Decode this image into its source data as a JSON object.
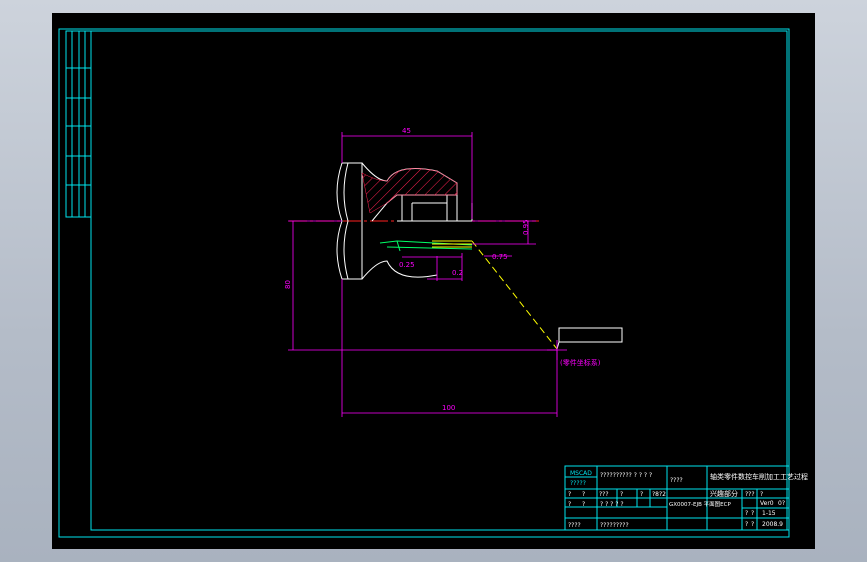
{
  "colors": {
    "frame": "#00e5ee",
    "dimension": "#ff00ff",
    "outline": "#ffffff",
    "centerline": "#ff2020",
    "hatch": "#ff2050",
    "toolpath": "#ffff00",
    "cutter": "#00ff66",
    "title_text": "#ffffff"
  },
  "dimensions": {
    "top_width": "45",
    "height_left": "80",
    "bottom_width": "100",
    "small_r": "0.95",
    "d1": "0.75",
    "d2": "0.25",
    "d3": "0.2"
  },
  "annotations": {
    "origin_label": "(零件坐标系)"
  },
  "title_block": {
    "company_mark": "MSCAD",
    "company_sub": "?????",
    "header_left": "??????????\n ? ? ? ?",
    "header_mid": "????",
    "drawing_title": "轴类零件数控车削加工工艺过程",
    "drawing_sub": "兴趣部分",
    "row1": [
      "?",
      "?",
      "???",
      "?",
      "?",
      "?8?2"
    ],
    "row2": [
      "?",
      "?",
      "? ? ? ? ?"
    ],
    "code": "GX0007-EJB 平面图ECP",
    "right1": [
      "???",
      "?"
    ],
    "right2": [
      "Ver0",
      "0?"
    ],
    "right3": [
      "?",
      "?",
      "1-15"
    ],
    "right4": [
      "?",
      "?",
      "2008.9"
    ],
    "bottom_left": "????",
    "bottom_mid": "?????????"
  }
}
